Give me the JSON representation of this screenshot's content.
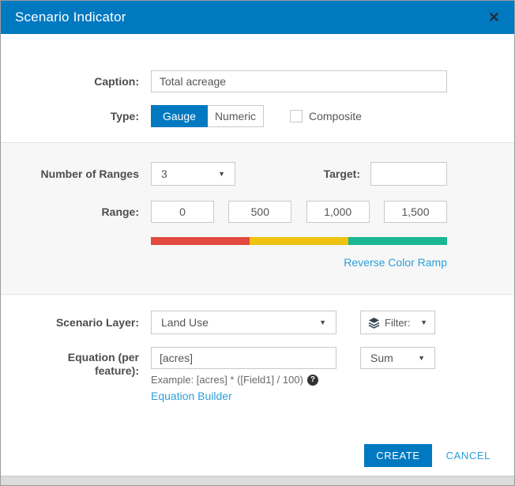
{
  "dialog": {
    "title": "Scenario Indicator",
    "caption": {
      "label": "Caption:",
      "value": "Total acreage"
    },
    "type": {
      "label": "Type:",
      "options": [
        {
          "label": "Gauge",
          "selected": true
        },
        {
          "label": "Numeric",
          "selected": false
        }
      ],
      "composite_label": "Composite",
      "composite_checked": false
    },
    "ranges": {
      "number_label": "Number of Ranges",
      "number_value": "3",
      "target_label": "Target:",
      "target_value": "",
      "range_label": "Range:",
      "values": [
        "0",
        "500",
        "1,000",
        "1,500"
      ],
      "ramp_colors": [
        "#e2493f",
        "#efc20e",
        "#1ab795"
      ],
      "reverse_link": "Reverse Color Ramp"
    },
    "scenario_layer": {
      "label": "Scenario Layer:",
      "value": "Land Use",
      "filter_label": "Filter:"
    },
    "equation": {
      "label": "Equation (per feature):",
      "value": "[acres]",
      "example": "Example: [acres] * ([Field1] / 100)",
      "builder_link": "Equation Builder",
      "aggregation_value": "Sum"
    },
    "footer": {
      "create_label": "CREATE",
      "cancel_label": "CANCEL"
    }
  },
  "icons": {
    "close": "✕",
    "caret": "▼",
    "help": "?"
  },
  "colors": {
    "accent": "#0079c1",
    "link": "#2d9fd9",
    "header": "#0079c1",
    "band": "#f7f7f7"
  }
}
